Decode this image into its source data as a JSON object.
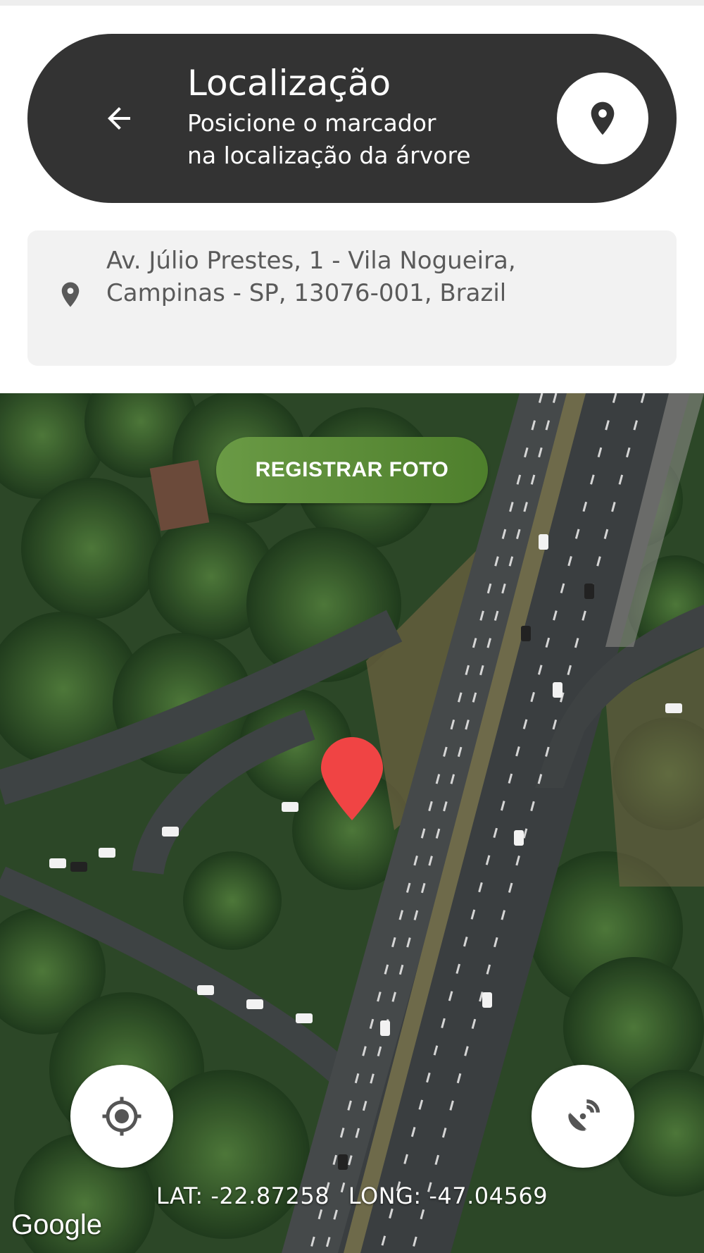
{
  "header": {
    "title": "Localização",
    "subtitle_line1": "Posicione o marcador",
    "subtitle_line2": "na localização da árvore",
    "back_icon": "arrow-left-icon",
    "pin_icon": "map-pin-icon",
    "background_color": "#333333"
  },
  "address": {
    "text": "Av. Júlio Prestes, 1 - Vila Nogueira,\nCampinas - SP, 13076-001, Brazil",
    "icon": "map-pin-icon"
  },
  "map": {
    "register_button_label": "REGISTRAR FOTO",
    "register_button_color": "#5a8a38",
    "marker_color": "#f04444",
    "lat_label": "LAT: -22.87258",
    "long_label": "LONG: -47.04569",
    "locate_icon": "crosshair-icon",
    "gps_icon": "satellite-dish-icon",
    "attribution": "Google"
  }
}
